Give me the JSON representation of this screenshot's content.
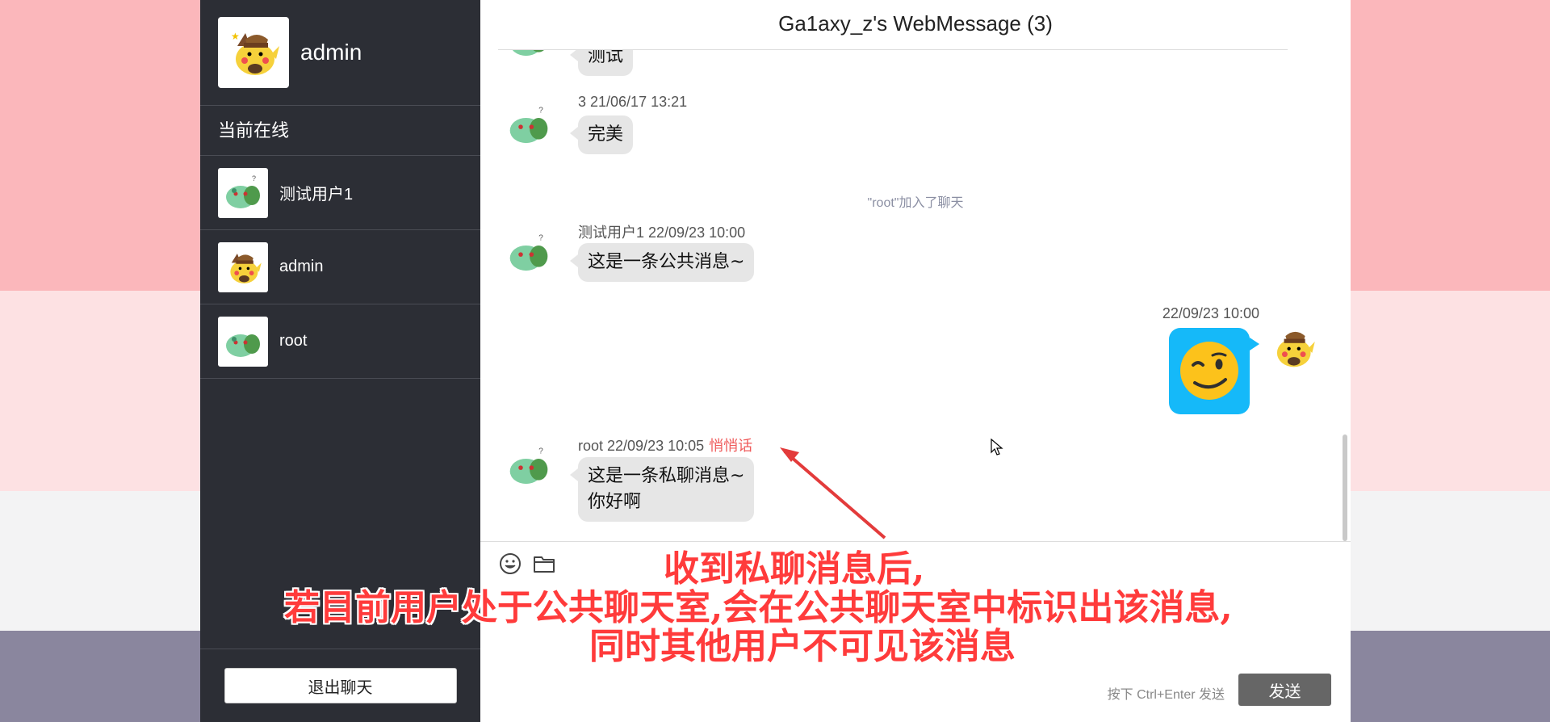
{
  "colors": {
    "sidebar_bg": "#2c2e35",
    "bubble_bg": "#e6e6e6",
    "sent_bubble_bg": "#15b9f9",
    "whisper_color": "#ef5b5b",
    "annotation_color": "#ff3b3b",
    "send_button_bg": "#666666"
  },
  "sidebar": {
    "current_user": {
      "name": "admin",
      "avatar": "pikachu-avatar"
    },
    "online_title": "当前在线",
    "online_users": [
      {
        "name": "测试用户1",
        "avatar": "bulbasaur-avatar"
      },
      {
        "name": "admin",
        "avatar": "pikachu-avatar"
      },
      {
        "name": "root",
        "avatar": "bulbasaur-avatar"
      }
    ],
    "logout_label": "退出聊天"
  },
  "header": {
    "title": "Ga1axy_z's WebMessage (3)"
  },
  "messages": [
    {
      "text": "测试",
      "avatar": "bulbasaur-avatar"
    },
    {
      "meta": "3 21/06/17 13:21",
      "text": "完美",
      "avatar": "bulbasaur-avatar"
    },
    {
      "system": "\"root\"加入了聊天"
    },
    {
      "meta": "测试用户1 22/09/23 10:00",
      "text": "这是一条公共消息~",
      "avatar": "bulbasaur-avatar"
    },
    {
      "meta": "22/09/23 10:00",
      "content": "wink-emoji",
      "avatar": "pikachu-avatar",
      "self": true
    },
    {
      "meta": "root 22/09/23 10:05",
      "whisper": "悄悄话",
      "line1": "这是一条私聊消息~",
      "line2": "你好啊",
      "avatar": "bulbasaur-avatar"
    }
  ],
  "input": {
    "emoji_icon": "smiley-icon",
    "file_icon": "folder-icon",
    "hint": "按下 Ctrl+Enter 发送",
    "send_label": "发送"
  },
  "annotation": {
    "line1": "收到私聊消息后,",
    "line2": "若目前用户处于公共聊天室,会在公共聊天室中标识出该消息,",
    "line3": "同时其他用户不可见该消息"
  }
}
